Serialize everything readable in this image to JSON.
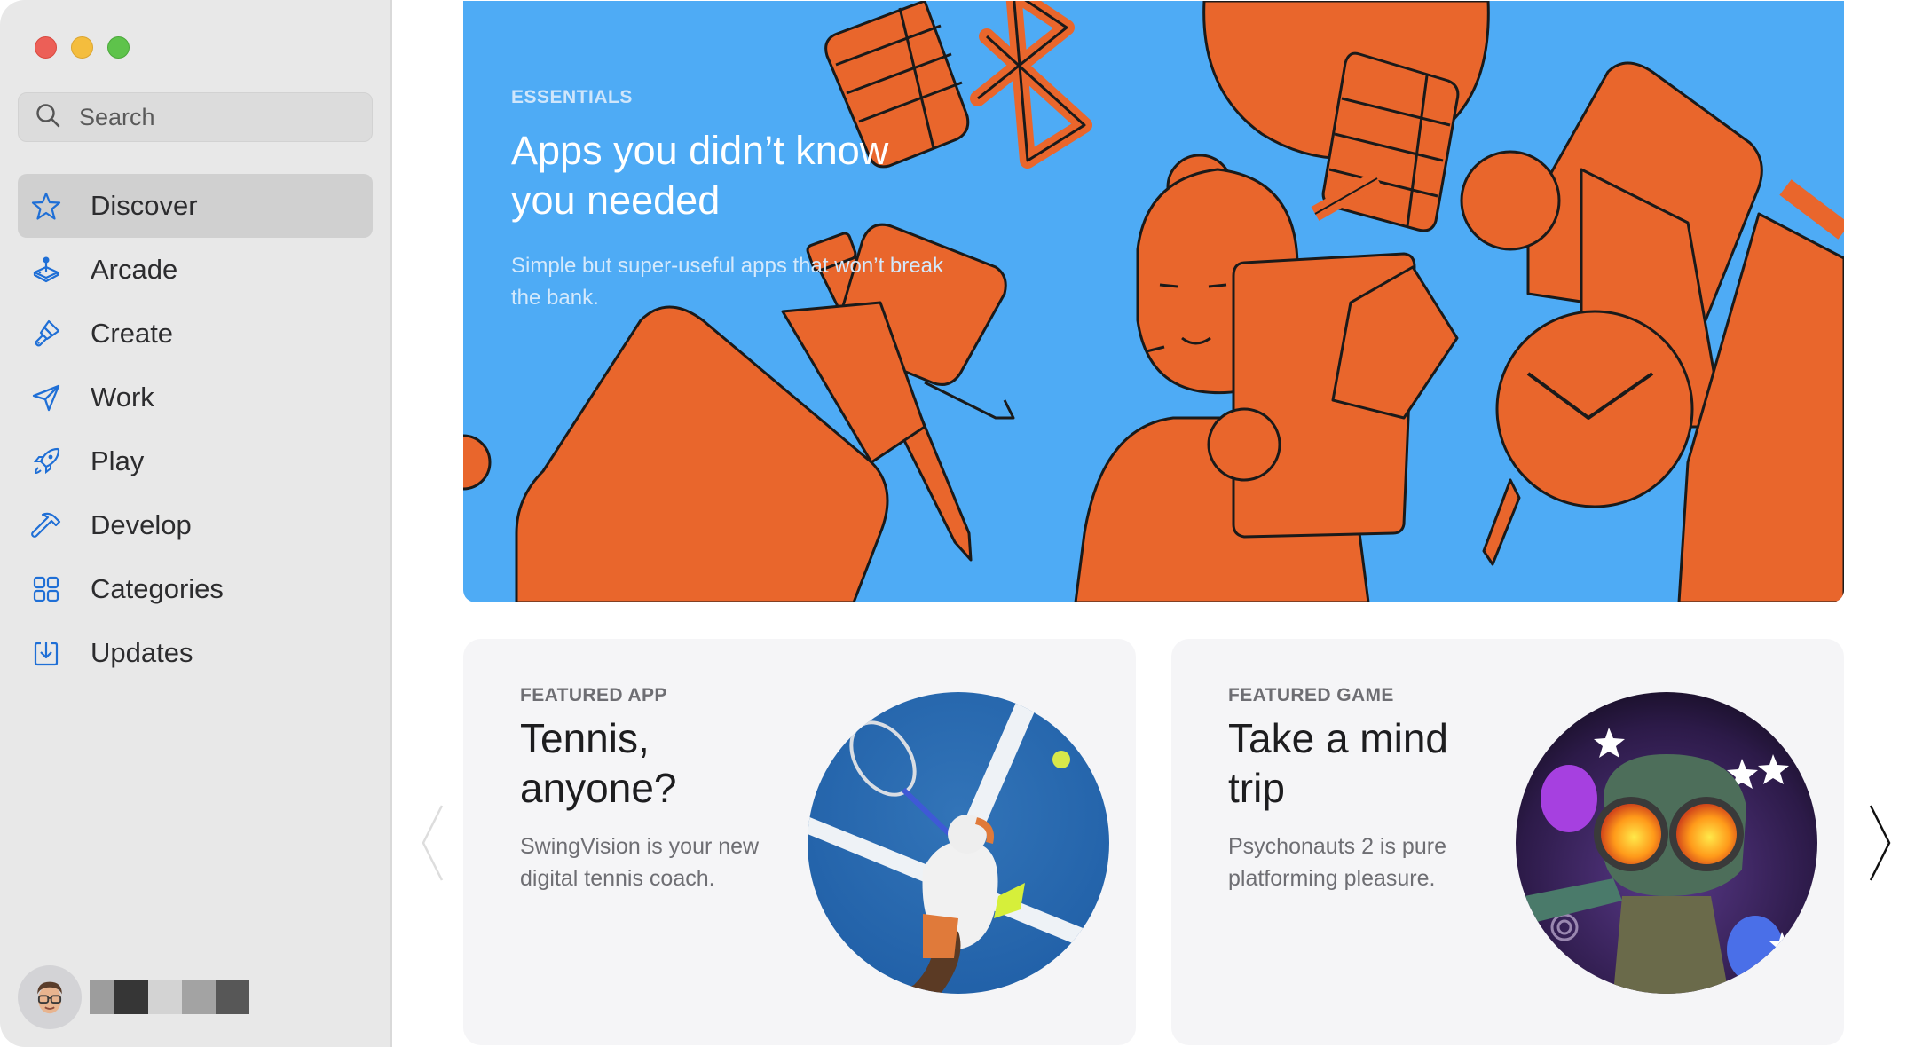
{
  "window": {
    "controls": [
      "close",
      "minimize",
      "zoom"
    ]
  },
  "sidebar": {
    "search": {
      "placeholder": "Search",
      "value": "",
      "icon": "search-icon"
    },
    "items": [
      {
        "label": "Discover",
        "icon": "star-icon",
        "active": true
      },
      {
        "label": "Arcade",
        "icon": "joystick-icon",
        "active": false
      },
      {
        "label": "Create",
        "icon": "paintbrush-icon",
        "active": false
      },
      {
        "label": "Work",
        "icon": "paperplane-icon",
        "active": false
      },
      {
        "label": "Play",
        "icon": "rocket-icon",
        "active": false
      },
      {
        "label": "Develop",
        "icon": "hammer-icon",
        "active": false
      },
      {
        "label": "Categories",
        "icon": "grid-icon",
        "active": false
      },
      {
        "label": "Updates",
        "icon": "download-icon",
        "active": false
      }
    ],
    "account": {
      "avatar": "memoji-avatar",
      "username_redacted": true
    }
  },
  "hero": {
    "eyebrow": "ESSENTIALS",
    "title_line1": "Apps you didn’t know",
    "title_line2": "you needed",
    "subtitle": "Simple but super-useful apps that won’t break the bank.",
    "background_color": "#4eabf5",
    "illustration_color": "#e9662c"
  },
  "cards": [
    {
      "eyebrow": "FEATURED APP",
      "title_line1": "Tennis,",
      "title_line2": "anyone?",
      "subtitle": "SwingVision is your new digital tennis coach.",
      "artwork": "tennis-player-artwork"
    },
    {
      "eyebrow": "FEATURED GAME",
      "title_line1": "Take a mind",
      "title_line2": "trip",
      "subtitle": "Psychonauts 2 is pure platforming pleasure.",
      "artwork": "psychonauts-artwork"
    }
  ],
  "carousel": {
    "prev_enabled": false,
    "next_enabled": true
  },
  "colors": {
    "accent": "#1f6fd6",
    "sidebar_bg": "#e8e8e8",
    "selected_bg": "#d0d0d0",
    "card_bg": "#f5f5f7"
  }
}
